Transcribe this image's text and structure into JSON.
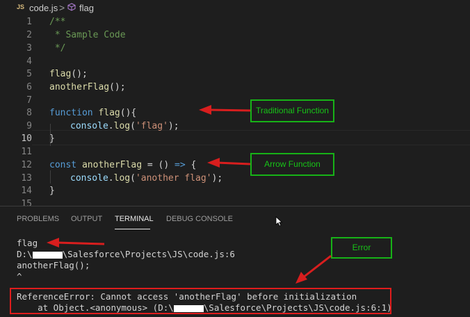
{
  "breadcrumb": {
    "file_badge": "JS",
    "file": "code.js",
    "separator": ">",
    "symbol": "flag"
  },
  "editor": {
    "line_numbers": [
      "1",
      "2",
      "3",
      "4",
      "5",
      "6",
      "7",
      "8",
      "9",
      "10",
      "11",
      "12",
      "13",
      "14",
      "15"
    ],
    "lines": {
      "l1": "/**",
      "l2": " * Sample Code",
      "l3": " */",
      "l5_fn": "flag",
      "l5_rest": "();",
      "l6_fn": "anotherFlag",
      "l6_rest": "();",
      "l8_kw": "function",
      "l8_fn": "flag",
      "l8_rest": "(){",
      "l9_obj": "console",
      "l9_dot": ".",
      "l9_fn": "log",
      "l9_open": "(",
      "l9_str": "'flag'",
      "l9_close": ");",
      "l10": "}",
      "l12_kw": "const",
      "l12_fn": "anotherFlag",
      "l12_rest": " = () ",
      "l12_arrow": "=>",
      "l12_brace": " {",
      "l13_obj": "console",
      "l13_dot": ".",
      "l13_fn": "log",
      "l13_open": "(",
      "l13_str": "'another flag'",
      "l13_close": ");",
      "l14": "}"
    }
  },
  "annotations": {
    "traditional": "Traditional Function",
    "arrow": "Arrow Function",
    "error": "Error"
  },
  "panel": {
    "tabs": [
      "PROBLEMS",
      "OUTPUT",
      "TERMINAL",
      "DEBUG CONSOLE"
    ],
    "active_tab": "TERMINAL"
  },
  "terminal": {
    "line1": "flag",
    "line2_a": "D:\\",
    "line2_b": "\\Salesforce\\Projects\\JS\\code.js:6",
    "line3": "anotherFlag();",
    "line4": "^",
    "error_line": "ReferenceError: Cannot access 'anotherFlag' before initialization",
    "trace_a": "    at Object.<anonymous> (D:\\",
    "trace_b": "\\Salesforce\\Projects\\JS\\code.js:6:1)"
  },
  "colors": {
    "annotation_green": "#17c417",
    "arrow_red": "#d81e1e",
    "error_border": "#e01c1c"
  }
}
